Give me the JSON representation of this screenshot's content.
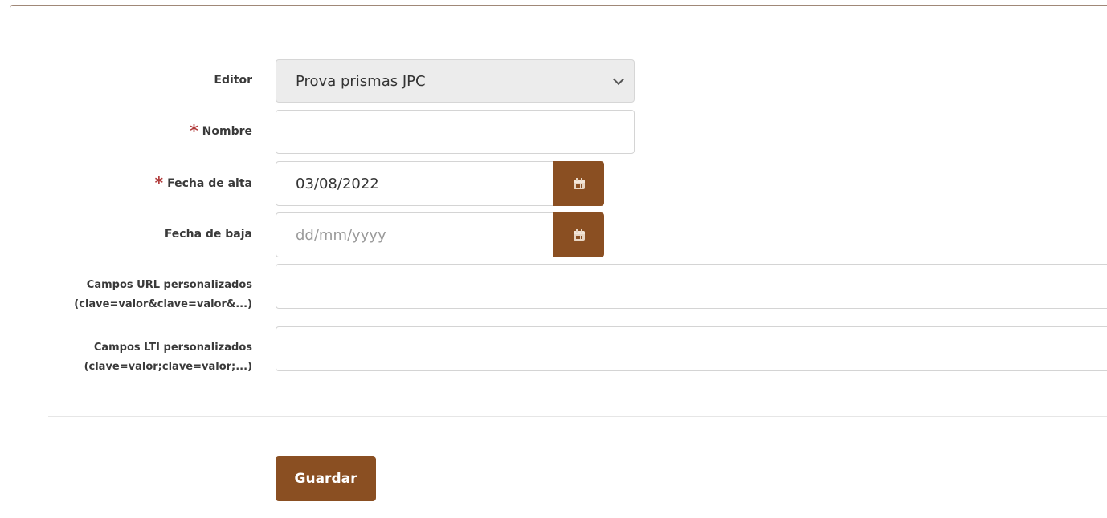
{
  "form": {
    "editor": {
      "label": "Editor",
      "value": "Prova prismas JPC"
    },
    "nombre": {
      "label": "Nombre",
      "required_mark": "*",
      "value": ""
    },
    "fecha_alta": {
      "label": "Fecha de alta",
      "required_mark": "*",
      "value": "03/08/2022",
      "button_icon": "calendar-icon"
    },
    "fecha_baja": {
      "label": "Fecha de baja",
      "placeholder": "dd/mm/yyyy",
      "value": "",
      "button_icon": "calendar-icon"
    },
    "campos_url": {
      "label_line1": "Campos URL personalizados",
      "label_line2": "(clave=valor&clave=valor&...)",
      "value": ""
    },
    "campos_lti": {
      "label_line1": "Campos LTI personalizados",
      "label_line2": "(clave=valor;clave=valor;...)",
      "value": ""
    },
    "save_label": "Guardar"
  },
  "colors": {
    "accent": "#8a4f22",
    "required": "#b03a3a"
  }
}
